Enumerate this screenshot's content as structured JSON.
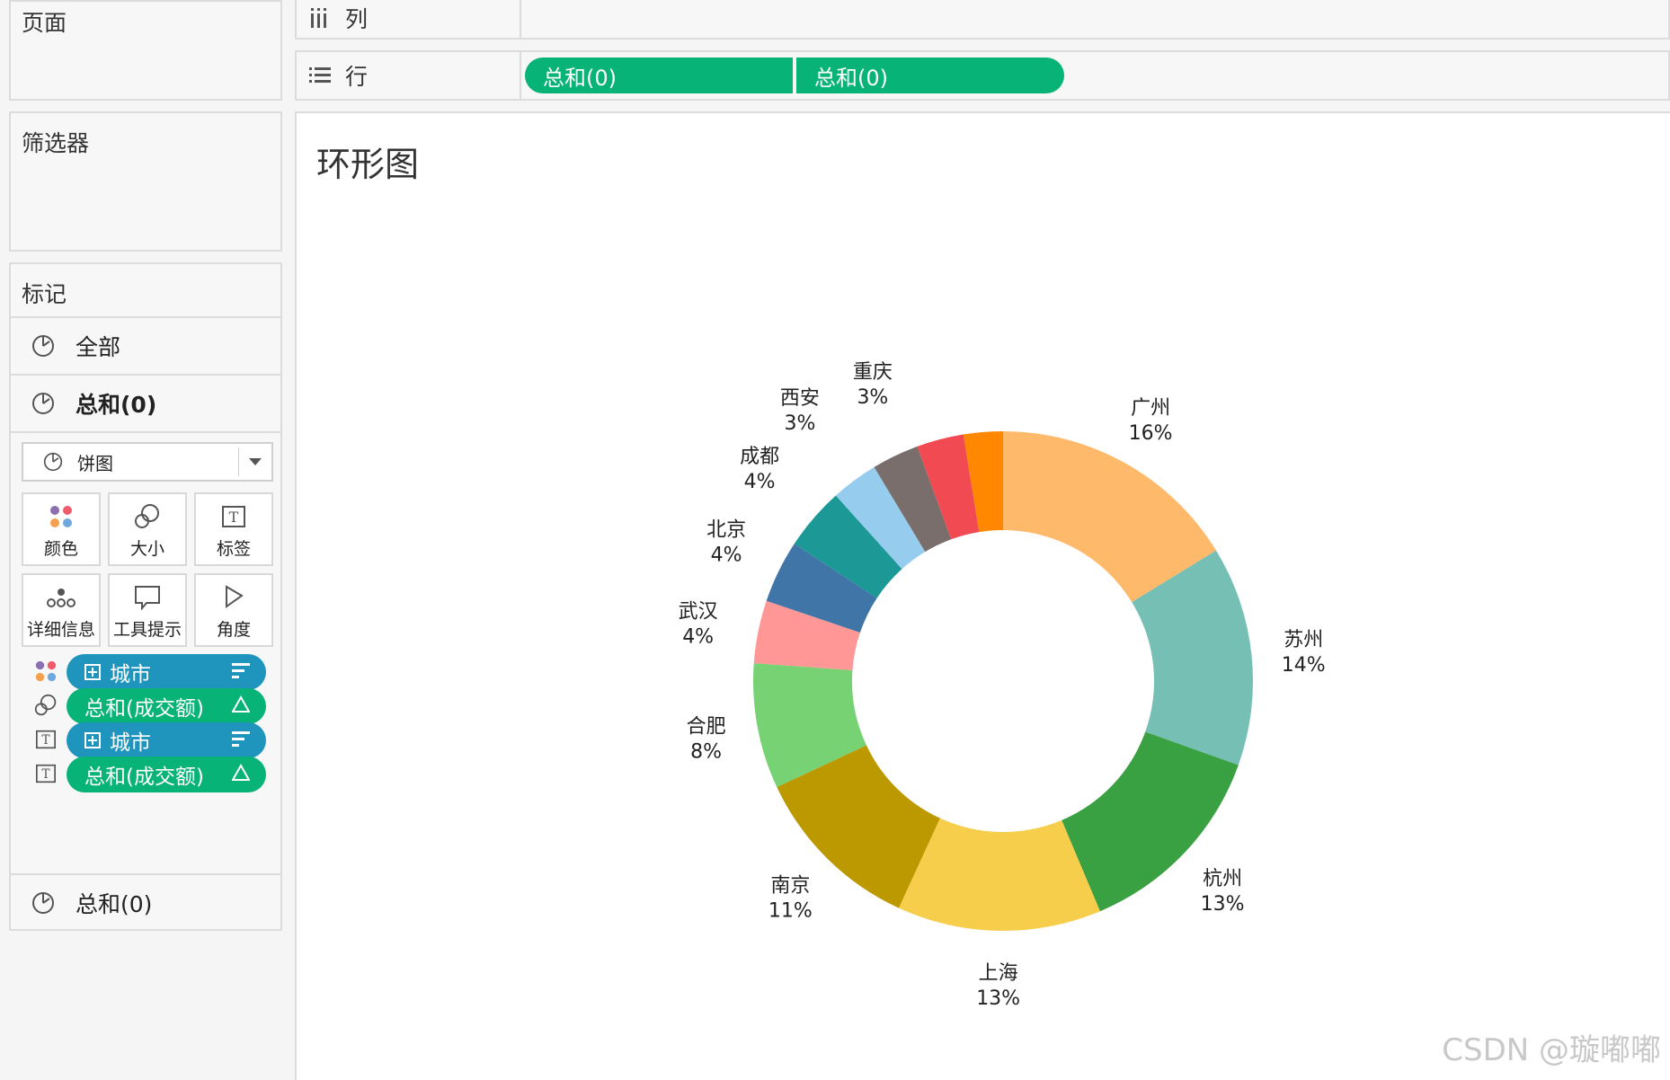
{
  "left": {
    "pages_title": "页面",
    "filters_title": "筛选器",
    "marks": {
      "title": "标记",
      "all_label": "全部",
      "sum_label": "总和(0)",
      "mark_type": "饼图",
      "cards": [
        "颜色",
        "大小",
        "标签",
        "详细信息",
        "工具提示",
        "角度"
      ],
      "pills": [
        {
          "kind": "color",
          "text": "城市",
          "type": "dimension"
        },
        {
          "kind": "size",
          "text": "总和(成交额)",
          "type": "measure"
        },
        {
          "kind": "label",
          "text": "城市",
          "type": "dimension"
        },
        {
          "kind": "label",
          "text": "总和(成交额)",
          "type": "measure"
        }
      ],
      "bottom_sum_label": "总和(0)"
    }
  },
  "shelves": {
    "columns_label": "列",
    "rows_label": "行",
    "rows_pills": [
      "总和(0)",
      "总和(0)"
    ]
  },
  "view": {
    "title": "环形图"
  },
  "watermark": "CSDN @璇嘟嘟",
  "colors": {
    "measure_pill": "#08b377",
    "dimension_pill": "#1f95bd"
  },
  "chart_data": {
    "type": "pie",
    "donut": true,
    "title": "",
    "slices": [
      {
        "label": "广州",
        "value": 16,
        "pct": "16%",
        "color": "#ffb96a"
      },
      {
        "label": "苏州",
        "value": 14,
        "pct": "14%",
        "color": "#76bfb4"
      },
      {
        "label": "杭州",
        "value": 13,
        "pct": "13%",
        "color": "#3aa143"
      },
      {
        "label": "上海",
        "value": 13,
        "pct": "13%",
        "color": "#f7cd4c"
      },
      {
        "label": "南京",
        "value": 11,
        "pct": "11%",
        "color": "#bd9900"
      },
      {
        "label": "合肥",
        "value": 8,
        "pct": "8%",
        "color": "#76d272"
      },
      {
        "label": "武汉",
        "value": 4,
        "pct": "4%",
        "color": "#ff9797"
      },
      {
        "label": "北京",
        "value": 4,
        "pct": "4%",
        "color": "#3f75a7"
      },
      {
        "label": "成都",
        "value": 4,
        "pct": "4%",
        "color": "#1c9996"
      },
      {
        "label": "西安",
        "value": 3,
        "pct": "3%",
        "color": "#96cced"
      },
      {
        "label": "重庆",
        "value": 3,
        "pct": "3%",
        "color": "#7a6e6c"
      },
      {
        "label": "",
        "value": 3,
        "pct": "",
        "color": "#f14a52"
      },
      {
        "label": "",
        "value": 2.5,
        "pct": "",
        "color": "#ff8800"
      }
    ]
  }
}
